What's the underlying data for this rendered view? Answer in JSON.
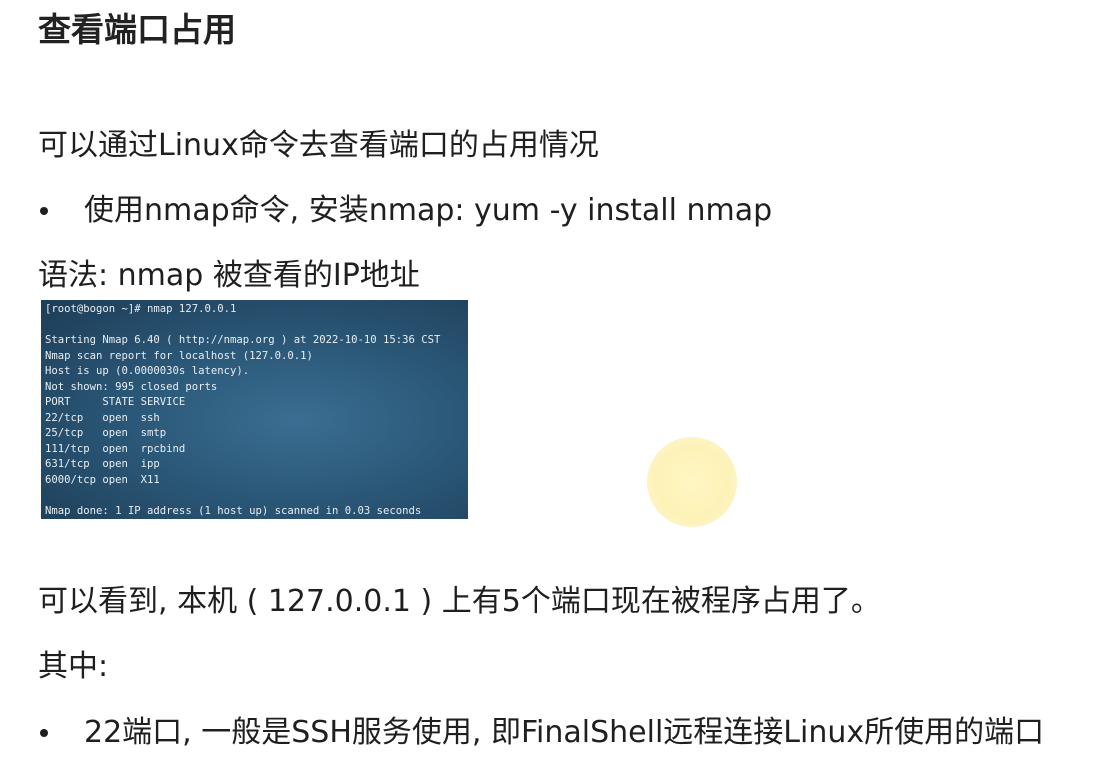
{
  "heading": "查看端口占用",
  "intro": "可以通过Linux命令去查看端口的占用情况",
  "bullet_install": "使用nmap命令, 安装nmap: yum -y install nmap",
  "syntax": "语法: nmap 被查看的IP地址",
  "terminal_lines": [
    "[root@bogon ~]# nmap 127.0.0.1",
    "",
    "Starting Nmap 6.40 ( http://nmap.org ) at 2022-10-10 15:36 CST",
    "Nmap scan report for localhost (127.0.0.1)",
    "Host is up (0.0000030s latency).",
    "Not shown: 995 closed ports",
    "PORT     STATE SERVICE",
    "22/tcp   open  ssh",
    "25/tcp   open  smtp",
    "111/tcp  open  rpcbind",
    "631/tcp  open  ipp",
    "6000/tcp open  X11",
    "",
    "Nmap done: 1 IP address (1 host up) scanned in 0.03 seconds"
  ],
  "conclusion": "可以看到, 本机 ( 127.0.0.1 ) 上有5个端口现在被程序占用了。",
  "among": "其中:",
  "bullet_port22": "22端口, 一般是SSH服务使用, 即FinalShell远程连接Linux所使用的端口"
}
